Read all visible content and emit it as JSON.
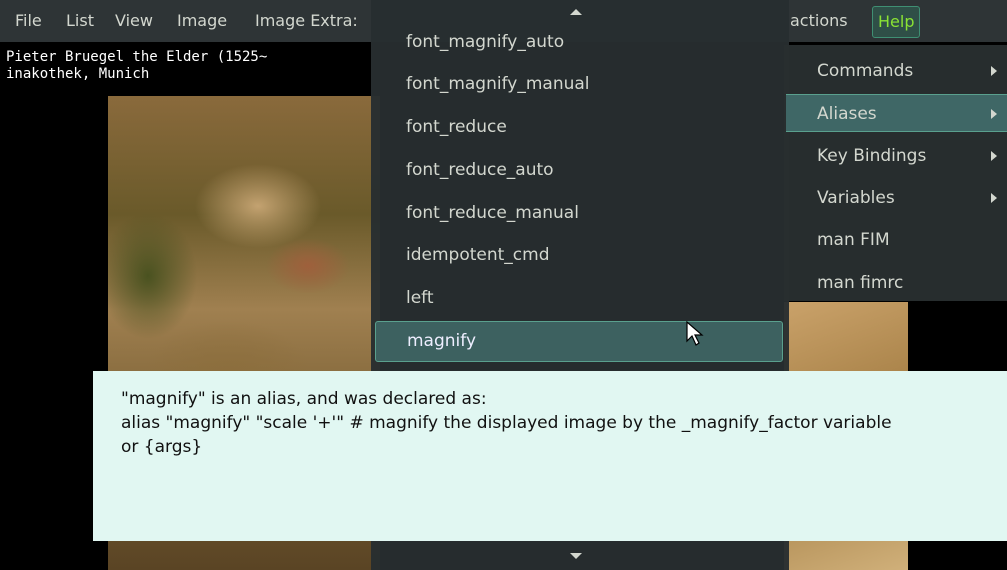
{
  "menubar": {
    "items": [
      "File",
      "List",
      "View",
      "Image",
      "Image Extra:",
      "actions",
      "Help"
    ]
  },
  "caption": {
    "line1": "Pieter Bruegel the Elder (1525~",
    "line2": "inakothek, Munich"
  },
  "aliases_menu": {
    "items": [
      "font_magnify_auto",
      "font_magnify_manual",
      "font_reduce",
      "font_reduce_auto",
      "font_reduce_manual",
      "idempotent_cmd",
      "left",
      "magnify"
    ],
    "selected": "magnify"
  },
  "help_menu": {
    "items": [
      {
        "label": "Commands",
        "has_submenu": true
      },
      {
        "label": "Aliases",
        "has_submenu": true
      },
      {
        "label": "Key Bindings",
        "has_submenu": true
      },
      {
        "label": "Variables",
        "has_submenu": true
      },
      {
        "label": "man FIM",
        "has_submenu": false
      },
      {
        "label": "man fimrc",
        "has_submenu": false
      }
    ],
    "selected": "Aliases"
  },
  "tooltip": {
    "line1": "\"magnify\" is an alias, and was declared as:",
    "line2": "alias \"magnify\" \"scale '+'\" # magnify the displayed image by the _magnify_factor variable",
    "line3": "or {args}"
  },
  "colors": {
    "menubar_bg": "#2e3436",
    "menu_text": "#d3d7cf",
    "help_accent": "#8ae234",
    "selection_bg": "#3d6160",
    "tooltip_bg": "#e1f7f2"
  }
}
